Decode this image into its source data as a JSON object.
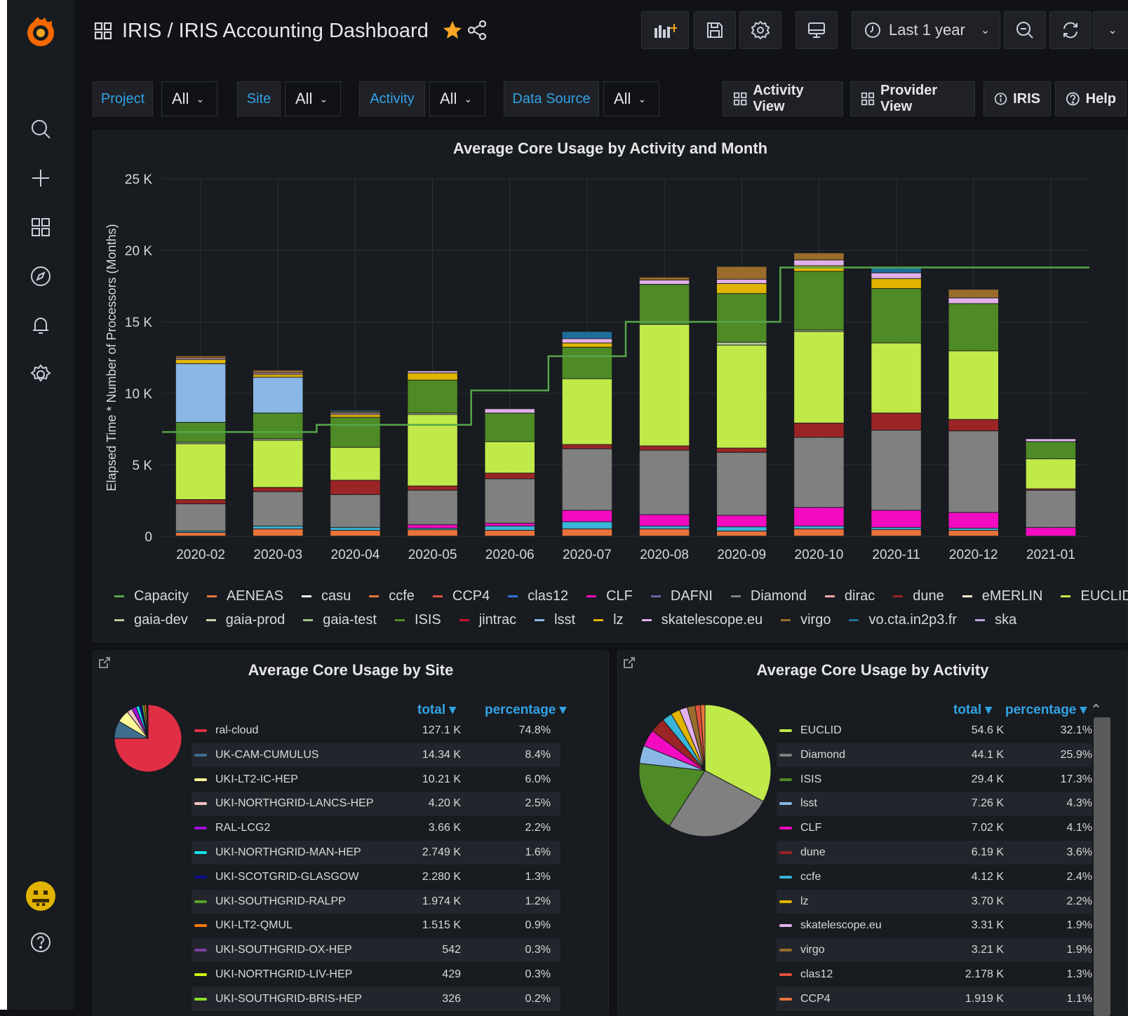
{
  "header": {
    "breadcrumb": "IRIS / IRIS Accounting Dashboard",
    "time_range": "Last 1 year"
  },
  "variables": [
    {
      "label": "Project",
      "value": "All"
    },
    {
      "label": "Site",
      "value": "All"
    },
    {
      "label": "Activity",
      "value": "All"
    },
    {
      "label": "Data Source",
      "value": "All"
    }
  ],
  "links": {
    "activity_view": "Activity View",
    "provider_view": "Provider View",
    "iris": "IRIS",
    "help": "Help"
  },
  "main_chart": {
    "title": "Average Core Usage by Activity and Month",
    "ylabel": "Elapsed Time * Number of Processors (Months)",
    "yticks": [
      "0",
      "5 K",
      "10 K",
      "15 K",
      "20 K",
      "25 K"
    ]
  },
  "chart_data": {
    "type": "bar",
    "stacked": true,
    "title": "Average Core Usage by Activity and Month",
    "ylabel": "Elapsed Time * Number of Processors (Months)",
    "ylim": [
      0,
      25000
    ],
    "categories": [
      "2020-02",
      "2020-03",
      "2020-04",
      "2020-05",
      "2020-06",
      "2020-07",
      "2020-08",
      "2020-09",
      "2020-10",
      "2020-11",
      "2020-12",
      "2021-01"
    ],
    "series": [
      {
        "name": "AENEAS",
        "color": "#e8743b",
        "values": [
          250,
          500,
          400,
          450,
          400,
          500,
          500,
          350,
          500,
          450,
          400,
          0
        ]
      },
      {
        "name": "ccfe",
        "color": "#3ab4d8",
        "values": [
          100,
          200,
          200,
          100,
          300,
          500,
          200,
          300,
          200,
          150,
          150,
          0
        ]
      },
      {
        "name": "CLF",
        "color": "#f20bc0",
        "values": [
          0,
          0,
          0,
          250,
          200,
          800,
          800,
          800,
          1300,
          1200,
          1100,
          600
        ]
      },
      {
        "name": "Diamond",
        "color": "#808080",
        "values": [
          1900,
          2400,
          2300,
          2400,
          3100,
          4300,
          4500,
          4400,
          4900,
          5600,
          5700,
          2600
        ]
      },
      {
        "name": "dune",
        "color": "#9b2425",
        "values": [
          300,
          300,
          1000,
          300,
          400,
          300,
          300,
          300,
          1000,
          1200,
          800,
          100
        ]
      },
      {
        "name": "EUCLID",
        "color": "#c0ea4a",
        "values": [
          3900,
          3300,
          2300,
          5000,
          2200,
          4600,
          8500,
          7200,
          6400,
          4900,
          4800,
          2100
        ]
      },
      {
        "name": "gaia-prod",
        "color": "#b5c99c",
        "values": [
          100,
          100,
          0,
          100,
          0,
          0,
          0,
          200,
          100,
          0,
          0,
          0
        ]
      },
      {
        "name": "ISIS",
        "color": "#4e8a26",
        "values": [
          1400,
          1800,
          2100,
          2300,
          2000,
          2200,
          2800,
          3400,
          4100,
          3800,
          3300,
          1200
        ]
      },
      {
        "name": "lsst",
        "color": "#8ab8e6",
        "values": [
          4100,
          2500,
          0,
          0,
          0,
          0,
          0,
          0,
          0,
          0,
          0,
          0
        ]
      },
      {
        "name": "lz",
        "color": "#e0b400",
        "values": [
          300,
          200,
          200,
          500,
          0,
          300,
          0,
          700,
          400,
          700,
          0,
          0
        ]
      },
      {
        "name": "skatelescope.eu",
        "color": "#e2b0ea",
        "values": [
          100,
          100,
          100,
          150,
          300,
          300,
          300,
          300,
          400,
          400,
          400,
          200
        ]
      },
      {
        "name": "virgo",
        "color": "#996c2b",
        "values": [
          150,
          200,
          100,
          0,
          0,
          0,
          200,
          900,
          500,
          0,
          600,
          0
        ]
      },
      {
        "name": "vo.cta.in2p3.fr",
        "color": "#1f6e9a",
        "values": [
          0,
          0,
          100,
          0,
          0,
          500,
          0,
          0,
          0,
          400,
          0,
          0
        ]
      }
    ],
    "capacity": {
      "name": "Capacity",
      "color": "#56a64b",
      "values": [
        7300,
        7300,
        7800,
        7800,
        10200,
        12600,
        15000,
        15000,
        18800,
        18800,
        18800,
        18800
      ]
    }
  },
  "legend": [
    {
      "name": "Capacity",
      "color": "#56a64b"
    },
    {
      "name": "AENEAS",
      "color": "#e8743b"
    },
    {
      "name": "casu",
      "color": "#f0f0f0"
    },
    {
      "name": "ccfe",
      "color": "#e8743b"
    },
    {
      "name": "CCP4",
      "color": "#e0503c"
    },
    {
      "name": "clas12",
      "color": "#3274d9"
    },
    {
      "name": "CLF",
      "color": "#f20bc0"
    },
    {
      "name": "DAFNI",
      "color": "#6b5fa8"
    },
    {
      "name": "Diamond",
      "color": "#808080"
    },
    {
      "name": "dirac",
      "color": "#f4a6a6"
    },
    {
      "name": "dune",
      "color": "#9b2425"
    },
    {
      "name": "eMERLIN",
      "color": "#fff2cc"
    },
    {
      "name": "EUCLID",
      "color": "#c0ea4a"
    },
    {
      "name": "gaia-dev",
      "color": "#b5c99c"
    },
    {
      "name": "gaia-prod",
      "color": "#c9d6a8"
    },
    {
      "name": "gaia-test",
      "color": "#a6c28a"
    },
    {
      "name": "ISIS",
      "color": "#4e8a26"
    },
    {
      "name": "jintrac",
      "color": "#c4162a"
    },
    {
      "name": "lsst",
      "color": "#8ab8e6"
    },
    {
      "name": "lz",
      "color": "#e0b400"
    },
    {
      "name": "skatelescope.eu",
      "color": "#e2b0ea"
    },
    {
      "name": "virgo",
      "color": "#996c2b"
    },
    {
      "name": "vo.cta.in2p3.fr",
      "color": "#1f6e9a"
    },
    {
      "name": "ska",
      "color": "#b7a6e0"
    }
  ],
  "site_panel": {
    "title": "Average Core Usage by Site",
    "col_total": "total",
    "col_pct": "percentage",
    "rows": [
      {
        "name": "ral-cloud",
        "total": "127.1 K",
        "pct": "74.8%",
        "color": "#e02f44"
      },
      {
        "name": "UK-CAM-CUMULUS",
        "total": "14.34 K",
        "pct": "8.4%",
        "color": "#3f6e8c"
      },
      {
        "name": "UKI-LT2-IC-HEP",
        "total": "10.21 K",
        "pct": "6.0%",
        "color": "#fff899"
      },
      {
        "name": "UKI-NORTHGRID-LANCS-HEP",
        "total": "4.20 K",
        "pct": "2.5%",
        "color": "#f4c3c3"
      },
      {
        "name": "RAL-LCG2",
        "total": "3.66 K",
        "pct": "2.2%",
        "color": "#a10fd8"
      },
      {
        "name": "UKI-NORTHGRID-MAN-HEP",
        "total": "2.749 K",
        "pct": "1.6%",
        "color": "#12e2f0"
      },
      {
        "name": "UKI-SCOTGRID-GLASGOW",
        "total": "2.280 K",
        "pct": "1.3%",
        "color": "#0a0a8c"
      },
      {
        "name": "UKI-SOUTHGRID-RALPP",
        "total": "1.974 K",
        "pct": "1.2%",
        "color": "#56a12a"
      },
      {
        "name": "UKI-LT2-QMUL",
        "total": "1.515 K",
        "pct": "0.9%",
        "color": "#ff780a"
      },
      {
        "name": "UKI-SOUTHGRID-OX-HEP",
        "total": "542",
        "pct": "0.3%",
        "color": "#7b3fa0"
      },
      {
        "name": "UKI-NORTHGRID-LIV-HEP",
        "total": "429",
        "pct": "0.3%",
        "color": "#d0f50a"
      },
      {
        "name": "UKI-SOUTHGRID-BRIS-HEP",
        "total": "326",
        "pct": "0.2%",
        "color": "#8ae02a"
      }
    ]
  },
  "activity_panel": {
    "title": "Average Core Usage by Activity",
    "col_total": "total",
    "col_pct": "percentage",
    "rows": [
      {
        "name": "EUCLID",
        "total": "54.6 K",
        "pct": "32.1%",
        "color": "#c0ea4a"
      },
      {
        "name": "Diamond",
        "total": "44.1 K",
        "pct": "25.9%",
        "color": "#808080"
      },
      {
        "name": "ISIS",
        "total": "29.4 K",
        "pct": "17.3%",
        "color": "#4e8a26"
      },
      {
        "name": "lsst",
        "total": "7.26 K",
        "pct": "4.3%",
        "color": "#8ab8e6"
      },
      {
        "name": "CLF",
        "total": "7.02 K",
        "pct": "4.1%",
        "color": "#f20bc0"
      },
      {
        "name": "dune",
        "total": "6.19 K",
        "pct": "3.6%",
        "color": "#9b2425"
      },
      {
        "name": "ccfe",
        "total": "4.12 K",
        "pct": "2.4%",
        "color": "#3ab4d8"
      },
      {
        "name": "lz",
        "total": "3.70 K",
        "pct": "2.2%",
        "color": "#e0b400"
      },
      {
        "name": "skatelescope.eu",
        "total": "3.31 K",
        "pct": "1.9%",
        "color": "#e2b0ea"
      },
      {
        "name": "virgo",
        "total": "3.21 K",
        "pct": "1.9%",
        "color": "#996c2b"
      },
      {
        "name": "clas12",
        "total": "2.178 K",
        "pct": "1.3%",
        "color": "#e0503c"
      },
      {
        "name": "CCP4",
        "total": "1.919 K",
        "pct": "1.1%",
        "color": "#e8743b"
      }
    ]
  }
}
